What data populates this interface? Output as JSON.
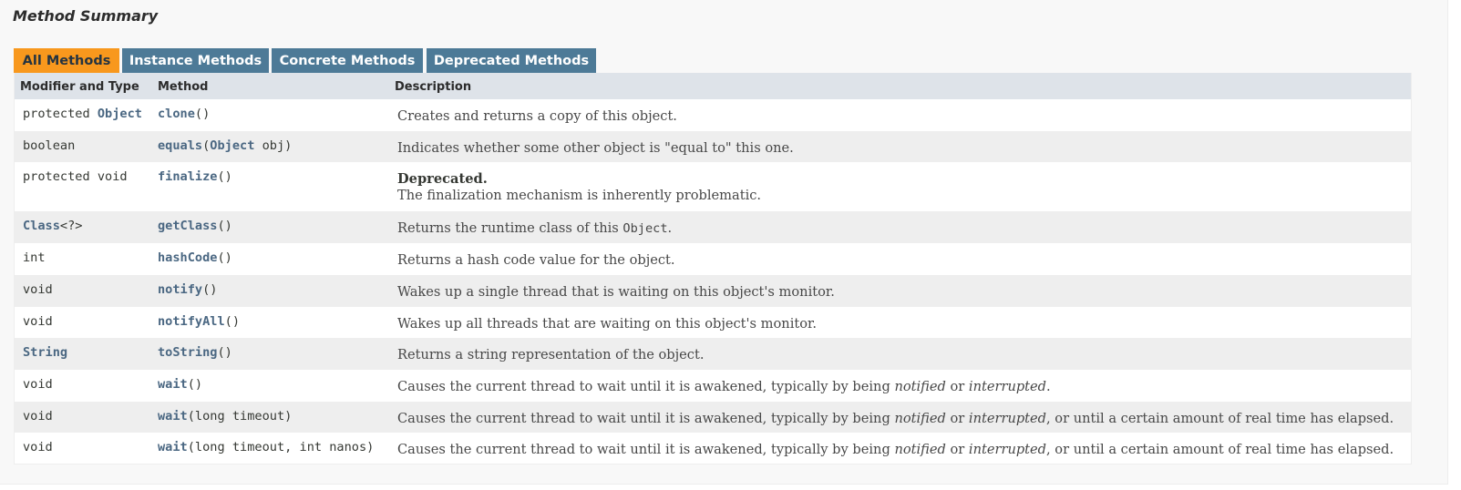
{
  "section_title": "Method Summary",
  "tabs": [
    {
      "label": "All Methods"
    },
    {
      "label": "Instance Methods"
    },
    {
      "label": "Concrete Methods"
    },
    {
      "label": "Deprecated Methods"
    }
  ],
  "columns": {
    "modifier": "Modifier and Type",
    "method": "Method",
    "description": "Description"
  },
  "methods": [
    {
      "mod_prefix": "protected ",
      "mod_link": "Object",
      "mod_suffix": "",
      "name": "clone",
      "params_before": "()",
      "params_link": "",
      "params_after": "",
      "desc": "Creates and returns a copy of this object."
    },
    {
      "mod_prefix": "boolean",
      "mod_link": "",
      "mod_suffix": "",
      "name": "equals",
      "params_before": "(",
      "params_link": "Object",
      "params_after": " obj)",
      "desc": "Indicates whether some other object is \"equal to\" this one."
    },
    {
      "mod_prefix": "protected void",
      "mod_link": "",
      "mod_suffix": "",
      "name": "finalize",
      "params_before": "()",
      "params_link": "",
      "params_after": "",
      "deprecated_label": "Deprecated.",
      "desc": "The finalization mechanism is inherently problematic."
    },
    {
      "mod_prefix": "",
      "mod_link": "Class",
      "mod_suffix": "<?>",
      "name": "getClass",
      "params_before": "()",
      "params_link": "",
      "params_after": "",
      "desc_before": "Returns the runtime class of this ",
      "desc_code": "Object",
      "desc_after": "."
    },
    {
      "mod_prefix": "int",
      "mod_link": "",
      "mod_suffix": "",
      "name": "hashCode",
      "params_before": "()",
      "params_link": "",
      "params_after": "",
      "desc": "Returns a hash code value for the object."
    },
    {
      "mod_prefix": "void",
      "mod_link": "",
      "mod_suffix": "",
      "name": "notify",
      "params_before": "()",
      "params_link": "",
      "params_after": "",
      "desc": "Wakes up a single thread that is waiting on this object's monitor."
    },
    {
      "mod_prefix": "void",
      "mod_link": "",
      "mod_suffix": "",
      "name": "notifyAll",
      "params_before": "()",
      "params_link": "",
      "params_after": "",
      "desc": "Wakes up all threads that are waiting on this object's monitor."
    },
    {
      "mod_prefix": "",
      "mod_link": "String",
      "mod_suffix": "",
      "name": "toString",
      "params_before": "()",
      "params_link": "",
      "params_after": "",
      "desc": "Returns a string representation of the object."
    },
    {
      "mod_prefix": "void",
      "mod_link": "",
      "mod_suffix": "",
      "name": "wait",
      "params_before": "()",
      "params_link": "",
      "params_after": "",
      "desc_parts": [
        "Causes the current thread to wait until it is awakened, typically by being ",
        "notified",
        " or ",
        "interrupted",
        "."
      ]
    },
    {
      "mod_prefix": "void",
      "mod_link": "",
      "mod_suffix": "",
      "name": "wait",
      "params_before": "(long timeout)",
      "params_link": "",
      "params_after": "",
      "desc_parts": [
        "Causes the current thread to wait until it is awakened, typically by being ",
        "notified",
        " or ",
        "interrupted",
        ", or until a certain amount of real time has elapsed."
      ]
    },
    {
      "mod_prefix": "void",
      "mod_link": "",
      "mod_suffix": "",
      "name": "wait",
      "params_before": "(long timeout, int nanos)",
      "params_link": "",
      "params_after": "",
      "desc_parts": [
        "Causes the current thread to wait until it is awakened, typically by being ",
        "notified",
        " or ",
        "interrupted",
        ", or until a certain amount of real time has elapsed."
      ]
    }
  ]
}
